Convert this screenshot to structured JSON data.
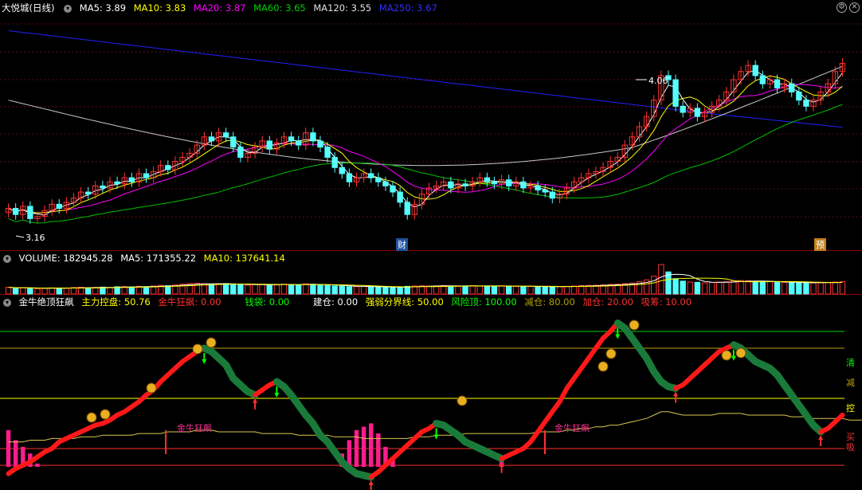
{
  "price_header": {
    "title": "大悦城(日线)",
    "ma5": "MA5: 3.89",
    "ma10": "MA10: 3.83",
    "ma20": "MA20: 3.87",
    "ma60": "MA60: 3.65",
    "ma120": "MA120: 3.55",
    "ma250": "MA250: 3.67"
  },
  "price_labels": {
    "high": "4.06",
    "low": "3.16",
    "marker_cai": "财",
    "marker_yu": "预"
  },
  "volume_header": {
    "title": "VOLUME: 182945.28",
    "ma5": "MA5: 171355.22",
    "ma10": "MA10: 137641.14"
  },
  "indicator_header": {
    "title": "金牛绝顶狂飙",
    "zhuli": "主力控盘: 50.76",
    "jinniu": "金牛狂飙: 0.00",
    "qiandai": "钱袋: 0.00",
    "jiancang": "建仓: 0.00",
    "qiangruo": "强弱分界线: 50.00",
    "fengxian": "风险顶: 100.00",
    "jiancang2": "减仓: 80.00",
    "jiacang": "加仓: 20.00",
    "xichou": "吸筹: 10.00"
  },
  "indicator_levels": {
    "qing": "清",
    "jian": "减",
    "kong": "控",
    "mai": "买",
    "xi": "吸"
  },
  "indicator_marks": {
    "jinniu1": "金牛狂飙",
    "jinniu2": "金牛狂飙"
  },
  "colors": {
    "ma5": "#ffffff",
    "ma10": "#ffff00",
    "ma20": "#ff00ff",
    "ma60": "#00c000",
    "ma120": "#c8c8c8",
    "ma250": "#2020ff",
    "up": "#ff3232",
    "down": "#54ffff"
  },
  "chart_data": {
    "type": "candlestick",
    "ylim": [
      3.1,
      4.2
    ],
    "annotations": {
      "high": 4.06,
      "low": 3.16
    },
    "close": [
      3.25,
      3.22,
      3.26,
      3.2,
      3.21,
      3.24,
      3.27,
      3.25,
      3.28,
      3.3,
      3.33,
      3.32,
      3.36,
      3.35,
      3.38,
      3.37,
      3.4,
      3.38,
      3.42,
      3.4,
      3.43,
      3.46,
      3.44,
      3.48,
      3.5,
      3.52,
      3.56,
      3.6,
      3.58,
      3.62,
      3.6,
      3.55,
      3.5,
      3.52,
      3.55,
      3.58,
      3.54,
      3.57,
      3.6,
      3.58,
      3.56,
      3.62,
      3.58,
      3.55,
      3.5,
      3.45,
      3.42,
      3.38,
      3.4,
      3.42,
      3.4,
      3.38,
      3.36,
      3.33,
      3.28,
      3.22,
      3.27,
      3.32,
      3.35,
      3.36,
      3.38,
      3.35,
      3.37,
      3.36,
      3.38,
      3.4,
      3.38,
      3.37,
      3.39,
      3.36,
      3.38,
      3.35,
      3.36,
      3.34,
      3.33,
      3.3,
      3.32,
      3.35,
      3.38,
      3.4,
      3.42,
      3.43,
      3.45,
      3.48,
      3.5,
      3.56,
      3.6,
      3.65,
      3.7,
      3.78,
      3.9,
      3.88,
      3.75,
      3.72,
      3.74,
      3.7,
      3.72,
      3.75,
      3.78,
      3.82,
      3.88,
      3.92,
      3.95,
      3.9,
      3.86,
      3.88,
      3.84,
      3.86,
      3.82,
      3.78,
      3.75,
      3.78,
      3.82,
      3.86,
      3.92,
      3.96
    ],
    "volume": [
      110,
      95,
      105,
      90,
      85,
      92,
      100,
      98,
      96,
      105,
      110,
      102,
      108,
      112,
      105,
      118,
      120,
      115,
      125,
      118,
      130,
      140,
      135,
      148,
      160,
      170,
      175,
      168,
      160,
      165,
      170,
      158,
      150,
      145,
      152,
      158,
      150,
      148,
      162,
      155,
      150,
      165,
      158,
      150,
      140,
      132,
      128,
      118,
      120,
      125,
      118,
      112,
      108,
      105,
      115,
      125,
      130,
      135,
      128,
      132,
      138,
      130,
      126,
      132,
      136,
      128,
      130,
      126,
      132,
      128,
      124,
      122,
      125,
      120,
      118,
      115,
      120,
      125,
      130,
      136,
      140,
      142,
      148,
      155,
      160,
      170,
      180,
      200,
      230,
      290,
      480,
      360,
      250,
      210,
      195,
      190,
      180,
      188,
      195,
      200,
      210,
      220,
      215,
      205,
      198,
      200,
      192,
      188,
      190,
      185,
      180,
      178,
      185,
      190,
      195,
      200
    ],
    "indicator": [
      5,
      8,
      10,
      12,
      15,
      18,
      20,
      24,
      26,
      28,
      30,
      32,
      34,
      35,
      37,
      40,
      42,
      45,
      48,
      52,
      55,
      60,
      64,
      68,
      72,
      75,
      78,
      80,
      78,
      74,
      70,
      62,
      58,
      54,
      52,
      55,
      58,
      60,
      57,
      52,
      46,
      40,
      35,
      28,
      24,
      18,
      12,
      8,
      5,
      4,
      3,
      6,
      10,
      14,
      18,
      22,
      26,
      30,
      32,
      35,
      34,
      31,
      28,
      24,
      22,
      20,
      18,
      16,
      14,
      16,
      18,
      20,
      24,
      30,
      36,
      42,
      48,
      56,
      62,
      68,
      74,
      80,
      86,
      90,
      95,
      92,
      86,
      80,
      74,
      66,
      60,
      57,
      56,
      58,
      62,
      66,
      70,
      74,
      78,
      80,
      82,
      80,
      76,
      72,
      70,
      68,
      64,
      58,
      52,
      46,
      40,
      34,
      30,
      32,
      36,
      40,
      46,
      52,
      58,
      60
    ],
    "gold_bull_line": [
      24,
      24,
      24,
      25,
      25,
      25,
      26,
      26,
      26,
      26,
      27,
      27,
      27,
      28,
      28,
      28,
      28,
      28,
      29,
      29,
      29,
      29,
      30,
      30,
      30,
      30,
      31,
      31,
      31,
      30,
      30,
      30,
      30,
      30,
      30,
      29,
      29,
      29,
      29,
      29,
      28,
      28,
      28,
      28,
      28,
      27,
      27,
      27,
      27,
      26,
      26,
      26,
      26,
      26,
      26,
      26,
      27,
      27,
      27,
      28,
      28,
      28,
      28,
      29,
      29,
      29,
      29,
      29,
      29,
      29,
      29,
      29,
      29,
      30,
      30,
      30,
      30,
      31,
      31,
      32,
      32,
      33,
      33,
      34,
      34,
      35,
      36,
      37,
      38,
      40,
      42,
      42,
      41,
      40,
      40,
      40,
      40,
      40,
      41,
      41,
      41,
      41,
      40,
      40,
      40,
      40,
      40,
      40,
      39,
      39,
      39,
      38,
      38,
      38,
      38,
      38,
      37,
      37,
      37,
      37
    ],
    "levels": {
      "qing": 90,
      "jian": 80,
      "kong": 50,
      "mai": 20,
      "xi": 10
    }
  }
}
